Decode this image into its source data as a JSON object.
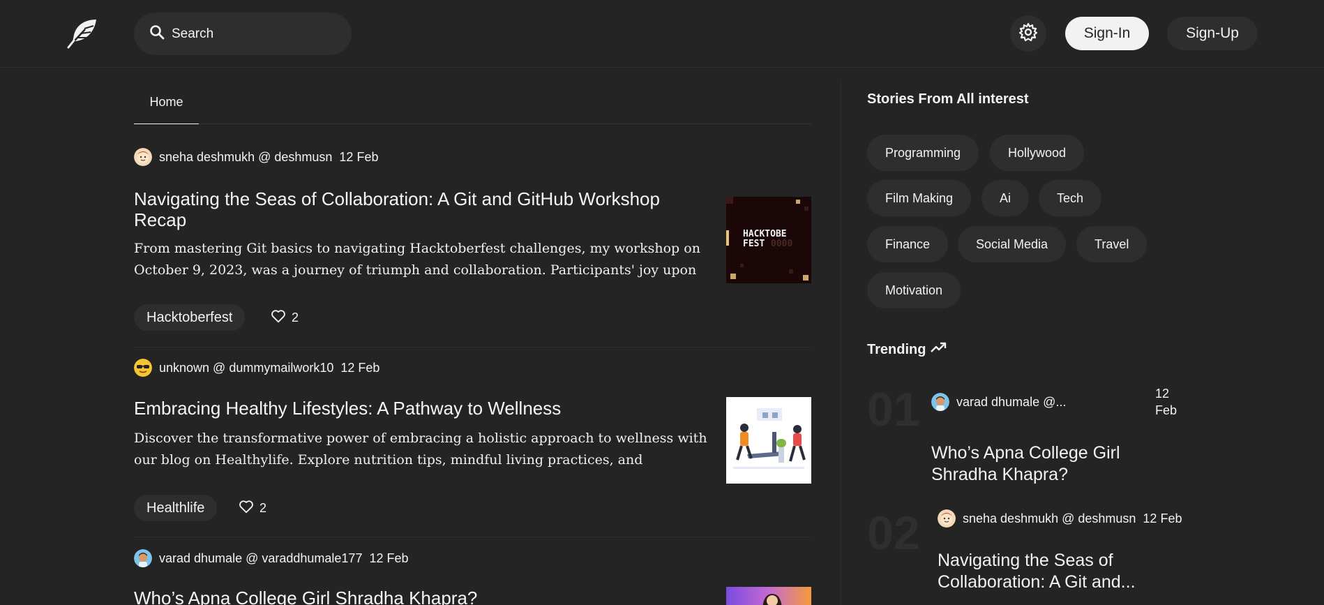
{
  "navbar": {
    "search_placeholder": "Search",
    "signin_label": "Sign-In",
    "signup_label": "Sign-Up",
    "logo_icon": "feather-icon",
    "theme_icon": "gear-icon"
  },
  "tabs": {
    "home": "Home"
  },
  "articles": [
    {
      "author": "sneha deshmukh @ deshmusn",
      "date": "12 Feb",
      "title": "Navigating the Seas of Collaboration: A Git and GitHub Workshop Recap",
      "excerpt": "From mastering Git basics to navigating Hacktoberfest challenges, my workshop on October 9, 2023, was a journey of triumph and collaboration. Participants' joy upon conquering...",
      "tag": "Hacktoberfest",
      "likes": "2",
      "thumb_text_1": "HACKTOBE",
      "thumb_text_2": "FEST"
    },
    {
      "author": "unknown @ dummymailwork10",
      "date": "12 Feb",
      "title": "Embracing Healthy Lifestyles: A Pathway to Wellness",
      "excerpt": "Discover the transformative power of embracing a holistic approach to wellness with our blog on Healthylife. Explore nutrition tips, mindful living practices, and strategies for...",
      "tag": "Healthlife",
      "likes": "2"
    },
    {
      "author": "varad dhumale @ varaddhumale177",
      "date": "12 Feb",
      "title": "Who’s Apna College Girl Shradha Khapra?"
    }
  ],
  "sidebar": {
    "interests_title": "Stories From All interest",
    "chips": [
      "Programming",
      "Hollywood",
      "Film Making",
      "Ai",
      "Tech",
      "Finance",
      "Social Media",
      "Travel",
      "Motivation"
    ],
    "trending_title": "Trending",
    "trending": [
      {
        "num": "01",
        "author": "varad dhumale @...",
        "date": "12 Feb",
        "title": "Who’s Apna College Girl Shradha Khapra?"
      },
      {
        "num": "02",
        "author": "sneha deshmukh @ deshmusn",
        "date": "12 Feb",
        "title": "Navigating the Seas of Collaboration: A Git and..."
      }
    ]
  },
  "colors": {
    "background": "#242424",
    "surface": "#2e2e2e",
    "text": "#f2f2f2"
  }
}
